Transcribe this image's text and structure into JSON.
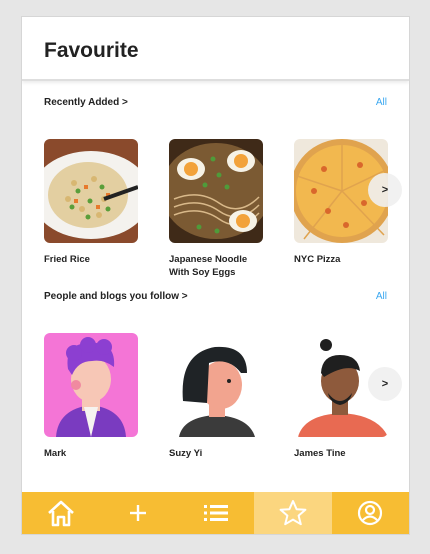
{
  "header": {
    "title": "Favourite"
  },
  "recent": {
    "title": "Recently Added >",
    "all_label": "All",
    "items": [
      {
        "label": "Fried Rice"
      },
      {
        "label": "Japanese Noodle With Soy Eggs"
      },
      {
        "label": "NYC Pizza"
      }
    ],
    "next_label": ">"
  },
  "people": {
    "title": "People and blogs you follow >",
    "all_label": "All",
    "items": [
      {
        "label": "Mark"
      },
      {
        "label": "Suzy Yi"
      },
      {
        "label": "James Tine"
      }
    ],
    "next_label": ">"
  },
  "tabbar": {
    "tabs": [
      {
        "icon": "home-icon"
      },
      {
        "icon": "plus-icon"
      },
      {
        "icon": "list-icon"
      },
      {
        "icon": "star-icon",
        "active": true
      },
      {
        "icon": "profile-icon"
      }
    ]
  },
  "colors": {
    "accent": "#39a7f0",
    "tabbar": "#f7bd33",
    "tabbar_active": "#fbd67f"
  }
}
